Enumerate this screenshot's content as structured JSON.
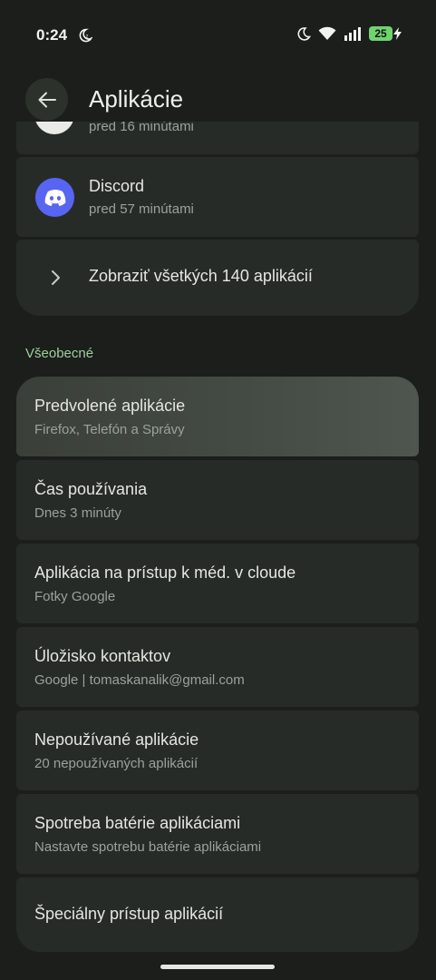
{
  "status_bar": {
    "time": "0:24",
    "battery_level": "25",
    "battery_color": "#6fd36f",
    "icons": [
      "dnd-moon-icon",
      "moon-icon",
      "wifi-icon",
      "signal-icon",
      "battery-icon",
      "charging-bolt-icon"
    ]
  },
  "app_bar": {
    "title": "Aplikácie",
    "back_icon": "arrow-back-icon"
  },
  "recent_apps": {
    "partial_item_subtitle": "pred 16 minútami",
    "discord": {
      "name": "Discord",
      "time": "pred 57 minútami",
      "icon_color": "#5865f2"
    },
    "see_all_label": "Zobraziť všetkých 140 aplikácií"
  },
  "general": {
    "header": "Všeobecné",
    "items": [
      {
        "title": "Predvolené aplikácie",
        "subtitle": "Firefox, Telefón a Správy"
      },
      {
        "title": "Čas používania",
        "subtitle": "Dnes 3 minúty"
      },
      {
        "title": "Aplikácia na prístup k méd. v cloude",
        "subtitle": "Fotky Google"
      },
      {
        "title": "Úložisko kontaktov",
        "subtitle": "Google | tomaskanalik@gmail.com"
      },
      {
        "title": "Nepoužívané aplikácie",
        "subtitle": "20 nepoužívaných aplikácií"
      },
      {
        "title": "Spotreba batérie aplikáciami",
        "subtitle": "Nastavte spotrebu batérie aplikáciami"
      },
      {
        "title": "Špeciálny prístup aplikácií",
        "subtitle": ""
      }
    ]
  },
  "colors": {
    "background": "#1b1e1b",
    "card": "#272b27",
    "pressed_card": "#4a504a",
    "section_header": "#9fcf9e"
  }
}
